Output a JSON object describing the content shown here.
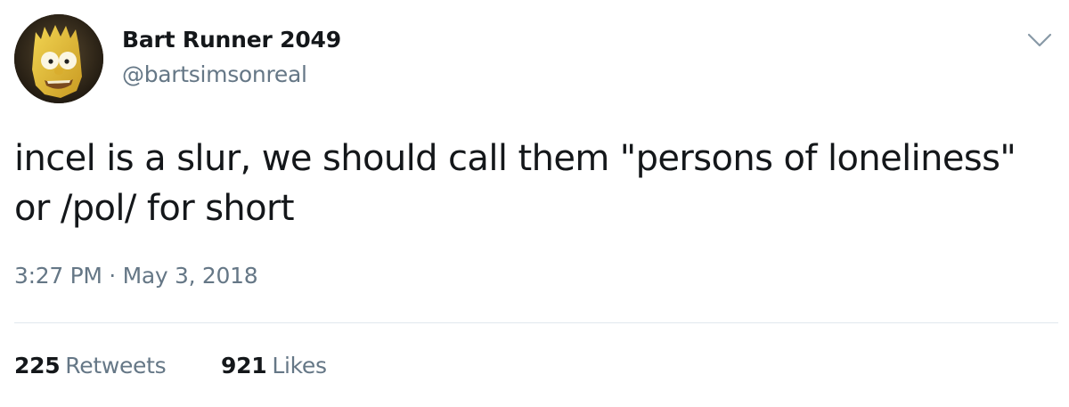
{
  "author": {
    "display_name": "Bart Runner 2049",
    "handle": "@bartsimsonreal",
    "avatar_icon": "bart-simpson-avatar"
  },
  "tweet": {
    "text": "incel is a slur, we should call them \"persons of loneliness\" or /pol/ for short",
    "timestamp": "3:27 PM · May 3, 2018"
  },
  "stats": {
    "retweets_count": "225",
    "retweets_label": "Retweets",
    "likes_count": "921",
    "likes_label": "Likes"
  },
  "menu": {
    "icon": "chevron-down-icon"
  },
  "colors": {
    "text_primary": "#14171a",
    "text_secondary": "#657786",
    "divider": "#e1e8ed",
    "avatar_skin": "#e8c23a"
  }
}
